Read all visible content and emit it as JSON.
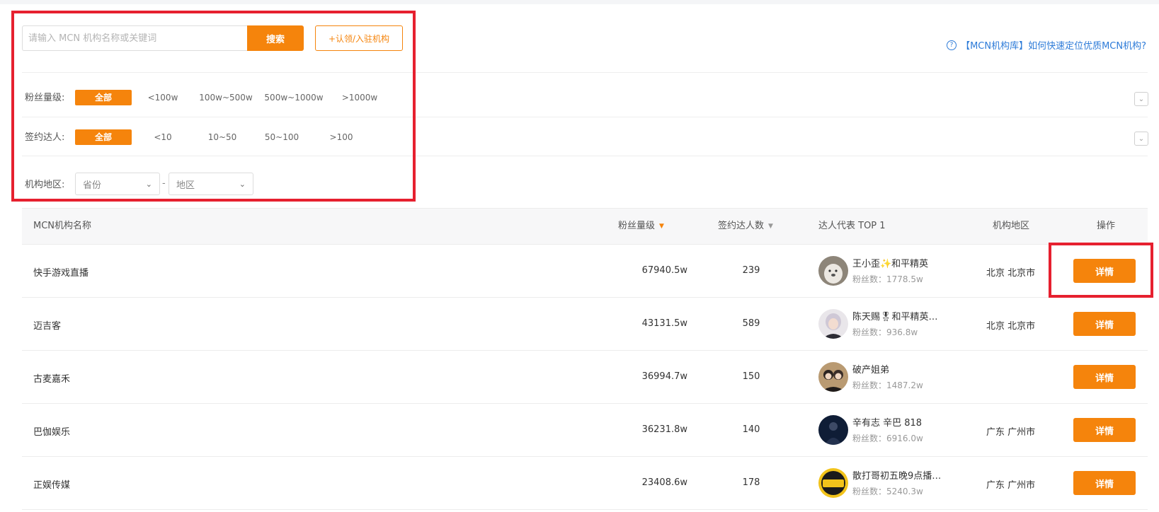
{
  "search": {
    "placeholder": "请输入 MCN 机构名称或关键词",
    "button_label": "搜索",
    "claim_label": "+认领/入驻机构"
  },
  "help": {
    "icon": "question-circle-icon",
    "text": "【MCN机构库】如何快速定位优质MCN机构?"
  },
  "filters": {
    "fans": {
      "label": "粉丝量级:",
      "options": [
        "全部",
        "<100w",
        "100w~500w",
        "500w~1000w",
        ">1000w"
      ]
    },
    "signed": {
      "label": "签约达人:",
      "options": [
        "全部",
        "<10",
        "10~50",
        "50~100",
        ">100"
      ]
    },
    "region": {
      "label": "机构地区:",
      "province_placeholder": "省份",
      "separator": "-",
      "area_placeholder": "地区"
    }
  },
  "table": {
    "headers": {
      "name": "MCN机构名称",
      "fans": "粉丝量级",
      "signed": "签约达人数",
      "top_kol": "达人代表 TOP 1",
      "region": "机构地区",
      "action": "操作"
    },
    "detail_label": "详情",
    "rows": [
      {
        "name": "快手游戏直播",
        "fans": "67940.5w",
        "signed": "239",
        "kol": "王小歪✨和平精英",
        "kol_fans": "粉丝数：1778.5w",
        "region": "北京 北京市"
      },
      {
        "name": "迈吉客",
        "fans": "43131.5w",
        "signed": "589",
        "kol": "陈天赐🎖和平精英…",
        "kol_fans": "粉丝数：936.8w",
        "region": "北京 北京市"
      },
      {
        "name": "古麦嘉禾",
        "fans": "36994.7w",
        "signed": "150",
        "kol": "破产姐弟",
        "kol_fans": "粉丝数：1487.2w",
        "region": ""
      },
      {
        "name": "巴伽娱乐",
        "fans": "36231.8w",
        "signed": "140",
        "kol": "辛有志 辛巴 818",
        "kol_fans": "粉丝数：6916.0w",
        "region": "广东 广州市"
      },
      {
        "name": "正娱传媒",
        "fans": "23408.6w",
        "signed": "178",
        "kol": "散打哥初五晚9点播…",
        "kol_fans": "粉丝数：5240.3w",
        "region": "广东 广州市"
      }
    ]
  },
  "colors": {
    "accent": "#f5840c",
    "highlight_box": "#e6202f",
    "link": "#2d7bd8"
  }
}
